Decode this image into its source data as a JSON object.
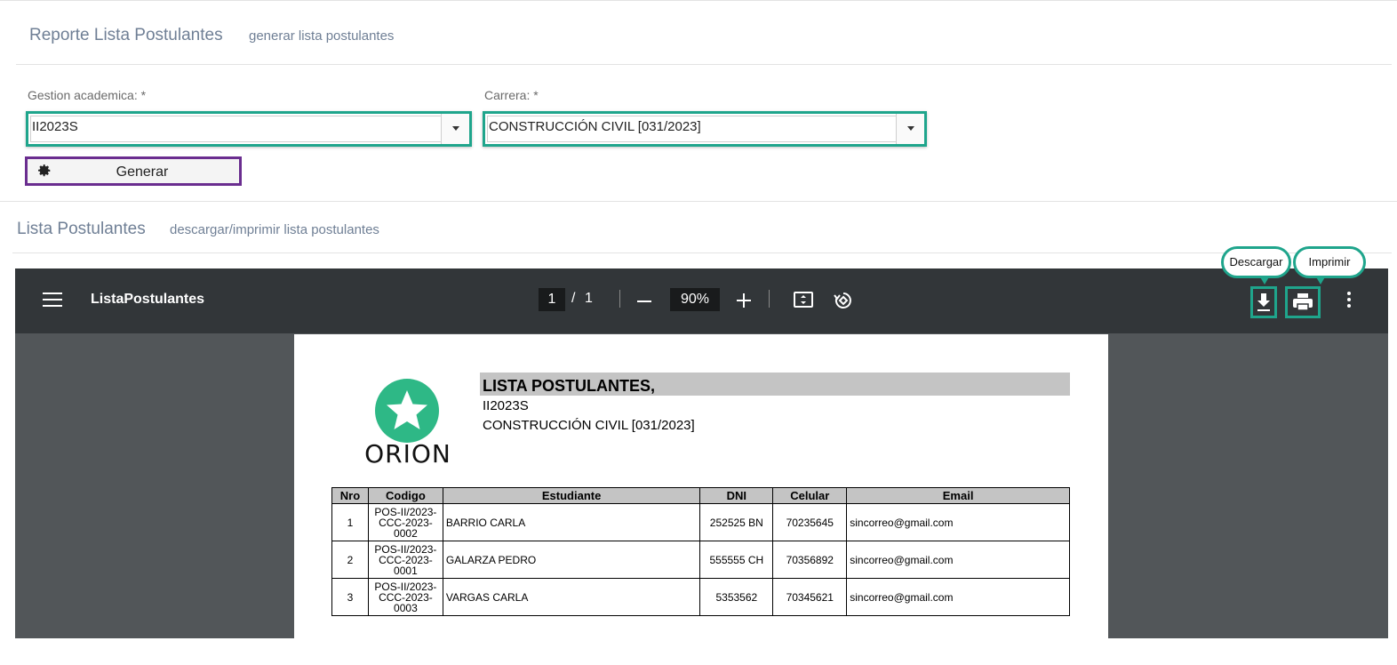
{
  "header": {
    "title": "Reporte Lista Postulantes",
    "subtitle": "generar lista postulantes"
  },
  "form": {
    "gestion_label": "Gestion academica:  *",
    "gestion_value": "II2023S",
    "carrera_label": "Carrera:  *",
    "carrera_value": "CONSTRUCCIÓN CIVIL [031/2023]",
    "generar_label": "Generar"
  },
  "section2": {
    "title": "Lista Postulantes",
    "subtitle": "descargar/imprimir lista postulantes"
  },
  "viewer": {
    "doc_title": "ListaPostulantes",
    "page_current": "1",
    "page_sep": "/",
    "page_total": "1",
    "zoom": "90%",
    "tooltip_download": "Descargar",
    "tooltip_print": "Imprimir"
  },
  "report": {
    "logo_text": "ORION",
    "title": "LISTA POSTULANTES,",
    "line1": "II2023S",
    "line2": "CONSTRUCCIÓN CIVIL [031/2023]",
    "columns": [
      "Nro",
      "Codigo",
      "Estudiante",
      "DNI",
      "Celular",
      "Email"
    ],
    "rows": [
      {
        "nro": "1",
        "codigo": [
          "POS-II/2023-",
          "CCC-2023-",
          "0002"
        ],
        "estudiante": "BARRIO CARLA",
        "dni": "252525 BN",
        "celular": "70235645",
        "email": "sincorreo@gmail.com"
      },
      {
        "nro": "2",
        "codigo": [
          "POS-II/2023-",
          "CCC-2023-",
          "0001"
        ],
        "estudiante": "GALARZA PEDRO",
        "dni": "555555 CH",
        "celular": "70356892",
        "email": "sincorreo@gmail.com"
      },
      {
        "nro": "3",
        "codigo": [
          "POS-II/2023-",
          "CCC-2023-",
          "0003"
        ],
        "estudiante": "VARGAS CARLA",
        "dni": "5353562",
        "celular": "70345621",
        "email": "sincorreo@gmail.com"
      }
    ]
  },
  "colors": {
    "accent_teal": "#1fa58c",
    "accent_purple": "#6a2d8f",
    "logo_green": "#2eb886"
  }
}
